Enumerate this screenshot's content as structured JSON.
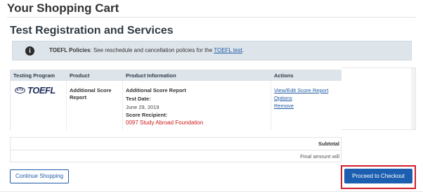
{
  "page": {
    "title": "Your Shopping Cart"
  },
  "section": {
    "title": "Test Registration and Services"
  },
  "policy": {
    "icon": "info-icon",
    "label": "TOEFL Policies",
    "text": ": See reschedule and cancellation policies for the ",
    "link": "TOEFL test",
    "end": "."
  },
  "table": {
    "headers": [
      "Testing Program",
      "Product",
      "Product Information",
      "Actions"
    ],
    "row": {
      "program_logo": {
        "badge": "ETS",
        "word": "TOEFL"
      },
      "product": "Additional Score Report",
      "info_title": "Additional Score Report",
      "test_date_label": "Test Date:",
      "test_date": "June 29, 2019",
      "recipient_label": "Score Recipient:",
      "recipient": "0097 Study Abroad Foundation",
      "actions": [
        "View/Edit Score Report",
        "Options",
        "Remove"
      ]
    }
  },
  "summary": {
    "subtotal_label": "Subtotal",
    "final_text": "Final amount will"
  },
  "buttons": {
    "continue": "Continue Shopping",
    "checkout": "Proceed to Checkout"
  },
  "colors": {
    "accent": "#1c5fb0",
    "highlight": "#d21f2a",
    "recipient": "#cc1a1a"
  }
}
